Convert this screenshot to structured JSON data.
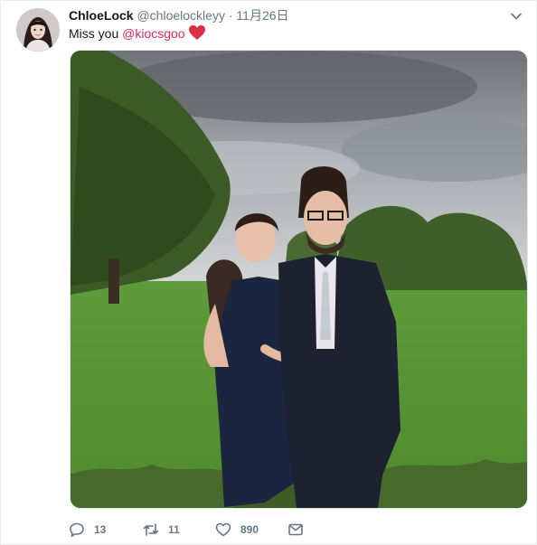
{
  "tweet": {
    "display_name": "ChloeLock",
    "handle": "@chloelockleyy",
    "separator": "·",
    "date": "11月26日",
    "text_prefix": "Miss you ",
    "mention": "@kiocsgoo",
    "emoji": "red-heart"
  },
  "actions": {
    "reply_count": "13",
    "retweet_count": "11",
    "like_count": "890"
  },
  "colors": {
    "name": "#14171a",
    "secondary": "#657786",
    "mention": "#e0245e",
    "heart": "#e0245e"
  },
  "icons": [
    "caret-down-icon",
    "reply-icon",
    "retweet-icon",
    "like-icon",
    "message-icon"
  ]
}
